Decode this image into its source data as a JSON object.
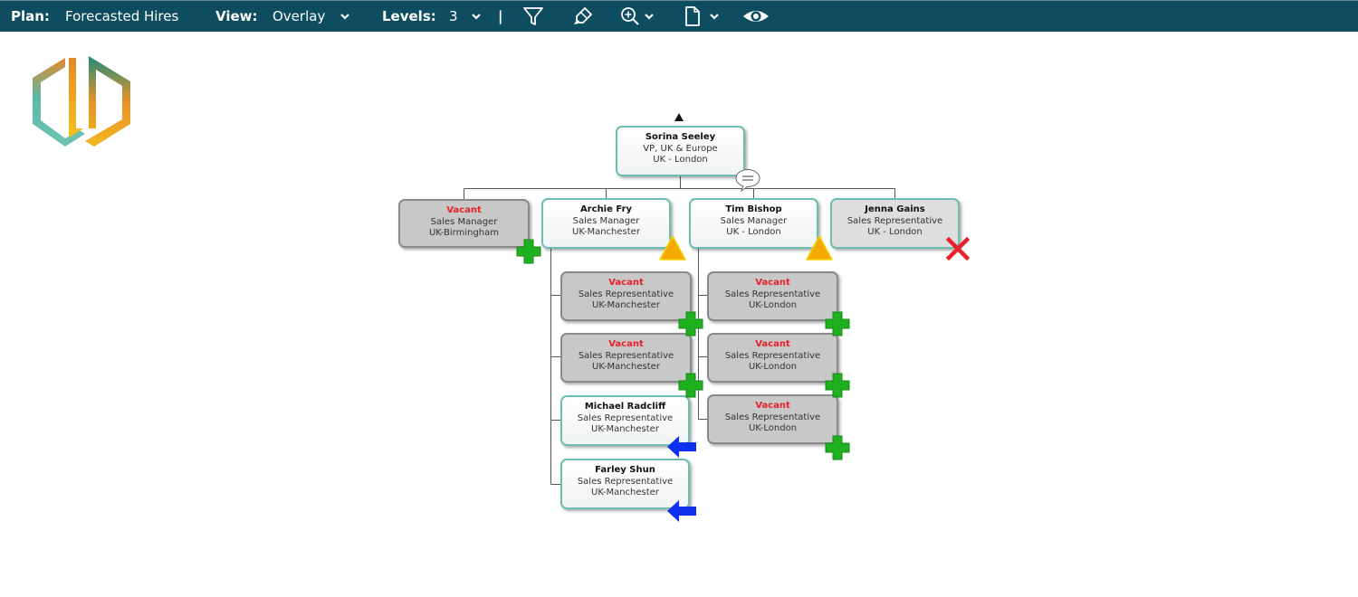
{
  "toolbar": {
    "plan_label": "Plan:",
    "plan_value": "Forecasted Hires",
    "view_label": "View:",
    "view_value": "Overlay",
    "levels_label": "Levels:",
    "levels_value": "3",
    "separator": "|",
    "icons": [
      "filter-icon",
      "highlighter-icon",
      "zoom-in-icon",
      "document-icon",
      "eye-icon"
    ]
  },
  "colors": {
    "toolbar_bg": "#0e4d60",
    "node_border": "#6dbdb2",
    "vacant_text": "#e8202a",
    "add_badge": "#1fb01f",
    "warning_badge": "#f5a800",
    "remove_badge": "#e8202a",
    "move_badge": "#1030f0"
  },
  "org": {
    "root": {
      "name": "Sorina Seeley",
      "title": "VP, UK & Europe",
      "location": "UK - London",
      "has_comment": true
    },
    "managers": [
      {
        "name": "Vacant",
        "title": "Sales Manager",
        "location": "UK-Birmingham",
        "vacant": true,
        "badge": "add"
      },
      {
        "name": "Archie Fry",
        "title": "Sales Manager",
        "location": "UK-Manchester",
        "vacant": false,
        "badge": "warning"
      },
      {
        "name": "Tim Bishop",
        "title": "Sales Manager",
        "location": "UK - London",
        "vacant": false,
        "badge": "warning"
      },
      {
        "name": "Jenna Gains",
        "title": "Sales Representative",
        "location": "UK - London",
        "vacant": false,
        "badge": "remove"
      }
    ],
    "archie_reports": [
      {
        "name": "Vacant",
        "title": "Sales Representative",
        "location": "UK-Manchester",
        "vacant": true,
        "badge": "add"
      },
      {
        "name": "Vacant",
        "title": "Sales Representative",
        "location": "UK-Manchester",
        "vacant": true,
        "badge": "add"
      },
      {
        "name": "Michael Radcliff",
        "title": "Sales Representative",
        "location": "UK-Manchester",
        "vacant": false,
        "badge": "move"
      },
      {
        "name": "Farley Shun",
        "title": "Sales Representative",
        "location": "UK-Manchester",
        "vacant": false,
        "badge": "move"
      }
    ],
    "tim_reports": [
      {
        "name": "Vacant",
        "title": "Sales Representative",
        "location": "UK-London",
        "vacant": true,
        "badge": "add"
      },
      {
        "name": "Vacant",
        "title": "Sales Representative",
        "location": "UK-London",
        "vacant": true,
        "badge": "add"
      },
      {
        "name": "Vacant",
        "title": "Sales Representative",
        "location": "UK-London",
        "vacant": true,
        "badge": "add"
      }
    ]
  }
}
